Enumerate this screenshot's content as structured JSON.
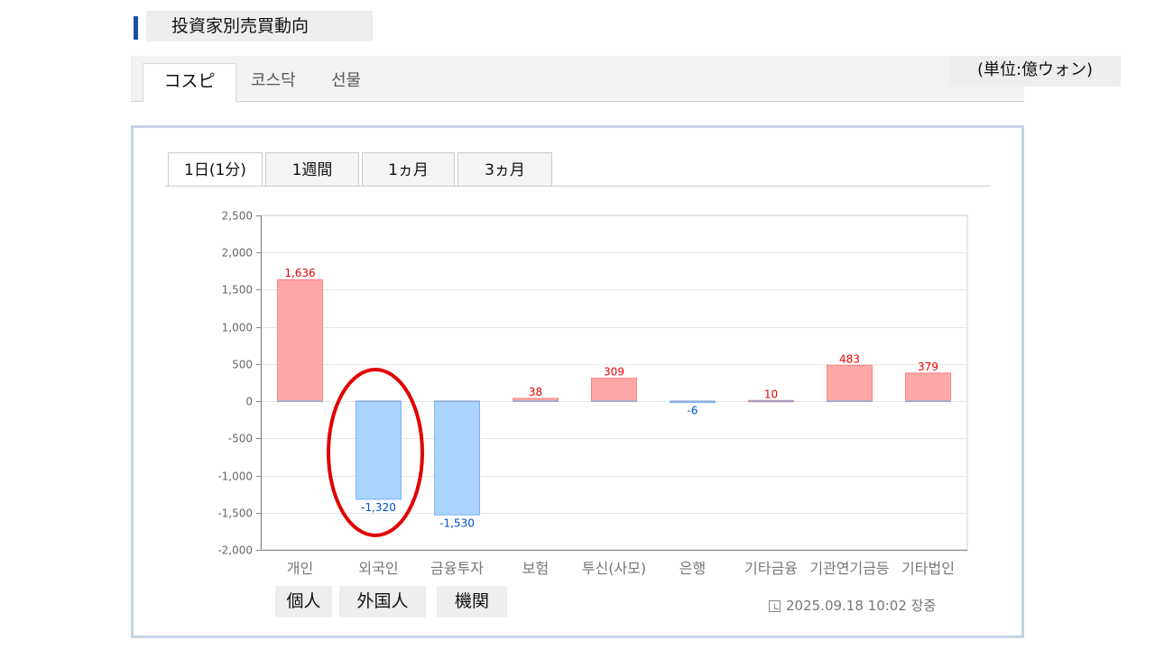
{
  "section_title": "投資家別売買動向",
  "market_tabs": [
    "コスピ",
    "코스닥",
    "선물"
  ],
  "unit_label": "(単位:億ウォン)",
  "period_tabs": [
    "1日(1分)",
    "1週間",
    "1ヵ月",
    "3ヵ月"
  ],
  "japanese_labels": [
    "個人",
    "外国人",
    "機関"
  ],
  "timestamp": "2025.09.18 10:02 장중",
  "colors": {
    "positive_fill": "#ffa8a8",
    "positive_stroke": "#ff8080",
    "negative_fill": "#abd3ff",
    "negative_stroke": "#7fb4f0",
    "positive_label": "#e60000",
    "negative_label": "#0050d0",
    "highlight_ellipse": "#e00000"
  },
  "chart_data": {
    "type": "bar",
    "categories": [
      "개인",
      "외국인",
      "금융투자",
      "보험",
      "투신(사모)",
      "은행",
      "기타금융",
      "기관연기금등",
      "기타법인"
    ],
    "values": [
      1636,
      -1320,
      -1530,
      38,
      309,
      -6,
      10,
      483,
      379
    ],
    "value_labels": [
      "1,636",
      "-1,320",
      "-1,530",
      "38",
      "309",
      "-6",
      "10",
      "483",
      "379"
    ],
    "ylim": [
      -2000,
      2500
    ],
    "yticks": [
      2500,
      2000,
      1500,
      1000,
      500,
      0,
      -500,
      -1000,
      -1500,
      -2000
    ],
    "ytick_labels": [
      "2,500",
      "2,000",
      "1,500",
      "1,000",
      "500",
      "0",
      "-500",
      "-1,000",
      "-1,500",
      "-2,000"
    ],
    "grid": true,
    "highlighted_category": "외국인"
  }
}
